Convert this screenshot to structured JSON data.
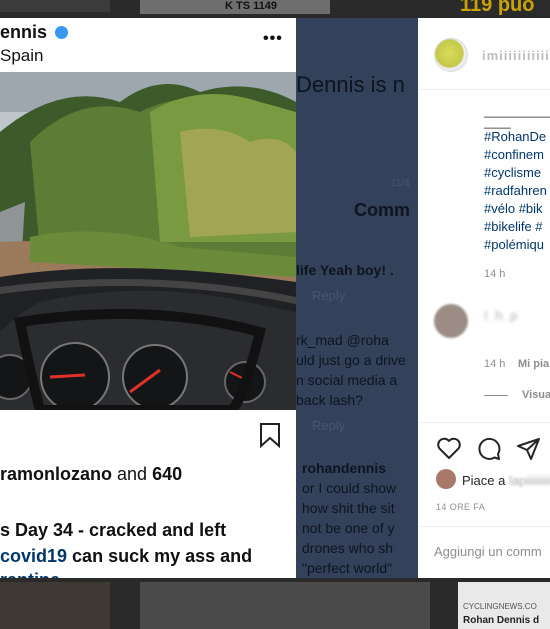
{
  "background_feed": {
    "top_plate": "K TS 1149",
    "top_corner_text": "119 puo",
    "bottom_source": "CYCLINGNEWS.CO",
    "bottom_headline": "Rohan Dennis d"
  },
  "post_screenshot": {
    "username": "ennis",
    "location": "Spain",
    "more_glyph": "•••",
    "liked_by_prefix": "",
    "liked_by_user": "ramonlozano",
    "liked_by_suffix": " and ",
    "liked_by_count": "640",
    "caption_line1": "s Day 34 - cracked and left",
    "caption_line2_tag": "covid19",
    "caption_line2_rest": " can suck my ass and",
    "caption_line3": "rantine"
  },
  "comments_screenshot": {
    "heading": "Dennis is n",
    "tab_label": "Comm",
    "date_fragment": "11/4",
    "comment1": "life Yeah boy! .",
    "reply1": "Reply",
    "comment2_user": "rk_mad @roha",
    "comment2_line2": "uld just go a drive",
    "comment2_line3": "n social media a",
    "comment2_line4": "back lash?",
    "reply2": "Reply",
    "comment3_user": "rohandennis",
    "comment3_line2": "or I could show",
    "comment3_line3": "how shit the sit",
    "comment3_line4": "not be one of y",
    "comment3_line5": "drones who sh",
    "comment3_line6": "\"perfect world\""
  },
  "right_panel": {
    "username": "imiiiiiiiiiiiiii",
    "dashes": "________________",
    "dashes_short": "____",
    "hashtags": [
      "#RohanDe",
      "#confinem",
      "#cyclisme",
      "#radfahren",
      "#vélo #bik",
      "#bikelife #",
      "#polémiqu"
    ],
    "time": "14 h",
    "comment_blurred": "l_h_p",
    "comment_time": "14 h",
    "comment_like": "Mi pia",
    "view_replies": "Visua",
    "likes_prefix": "Piace a ",
    "likes_user": "lapiiiiiiiii",
    "date": "14 ORE FA",
    "add_comment_placeholder": "Aggiungi un comm"
  }
}
